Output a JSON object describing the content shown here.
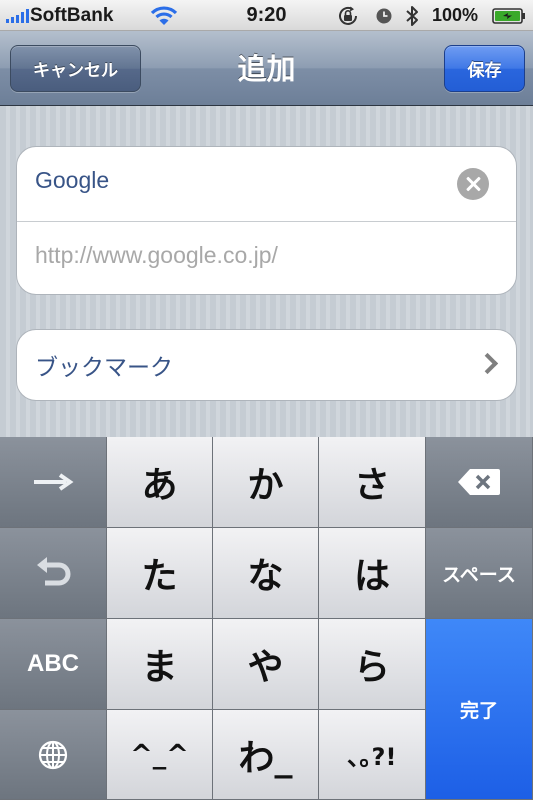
{
  "status_bar": {
    "carrier": "SoftBank",
    "time": "9:20",
    "battery_percent": "100%",
    "icons": [
      "signal-icon",
      "wifi-icon",
      "rotation-lock-icon",
      "alarm-icon",
      "bluetooth-icon",
      "battery-icon"
    ]
  },
  "nav": {
    "cancel_label": "キャンセル",
    "title": "追加",
    "save_label": "保存"
  },
  "form": {
    "title_value": "Google",
    "url_value": "http://www.google.co.jp/",
    "folder_label": "ブックマーク"
  },
  "keyboard": {
    "rows": [
      [
        "→",
        "あ",
        "か",
        "さ",
        "delete"
      ],
      [
        "undo",
        "た",
        "な",
        "は",
        "スペース"
      ],
      [
        "ABC",
        "ま",
        "や",
        "ら",
        "完了"
      ],
      [
        "globe",
        "^^",
        "わ_",
        "､｡?!"
      ]
    ],
    "arrow_label": "→",
    "keys": {
      "a": "あ",
      "ka": "か",
      "sa": "さ",
      "ta": "た",
      "na": "な",
      "ha": "は",
      "ma": "ま",
      "ya": "や",
      "ra": "ら",
      "emoticon": "^_^",
      "wa": "わ_",
      "punct": "､｡?!"
    },
    "space_label": "スペース",
    "abc_label": "ABC",
    "done_label": "完了"
  },
  "colors": {
    "nav_accent": "#2a66de",
    "field_text": "#385487",
    "done_key": "#1d5fe6"
  }
}
